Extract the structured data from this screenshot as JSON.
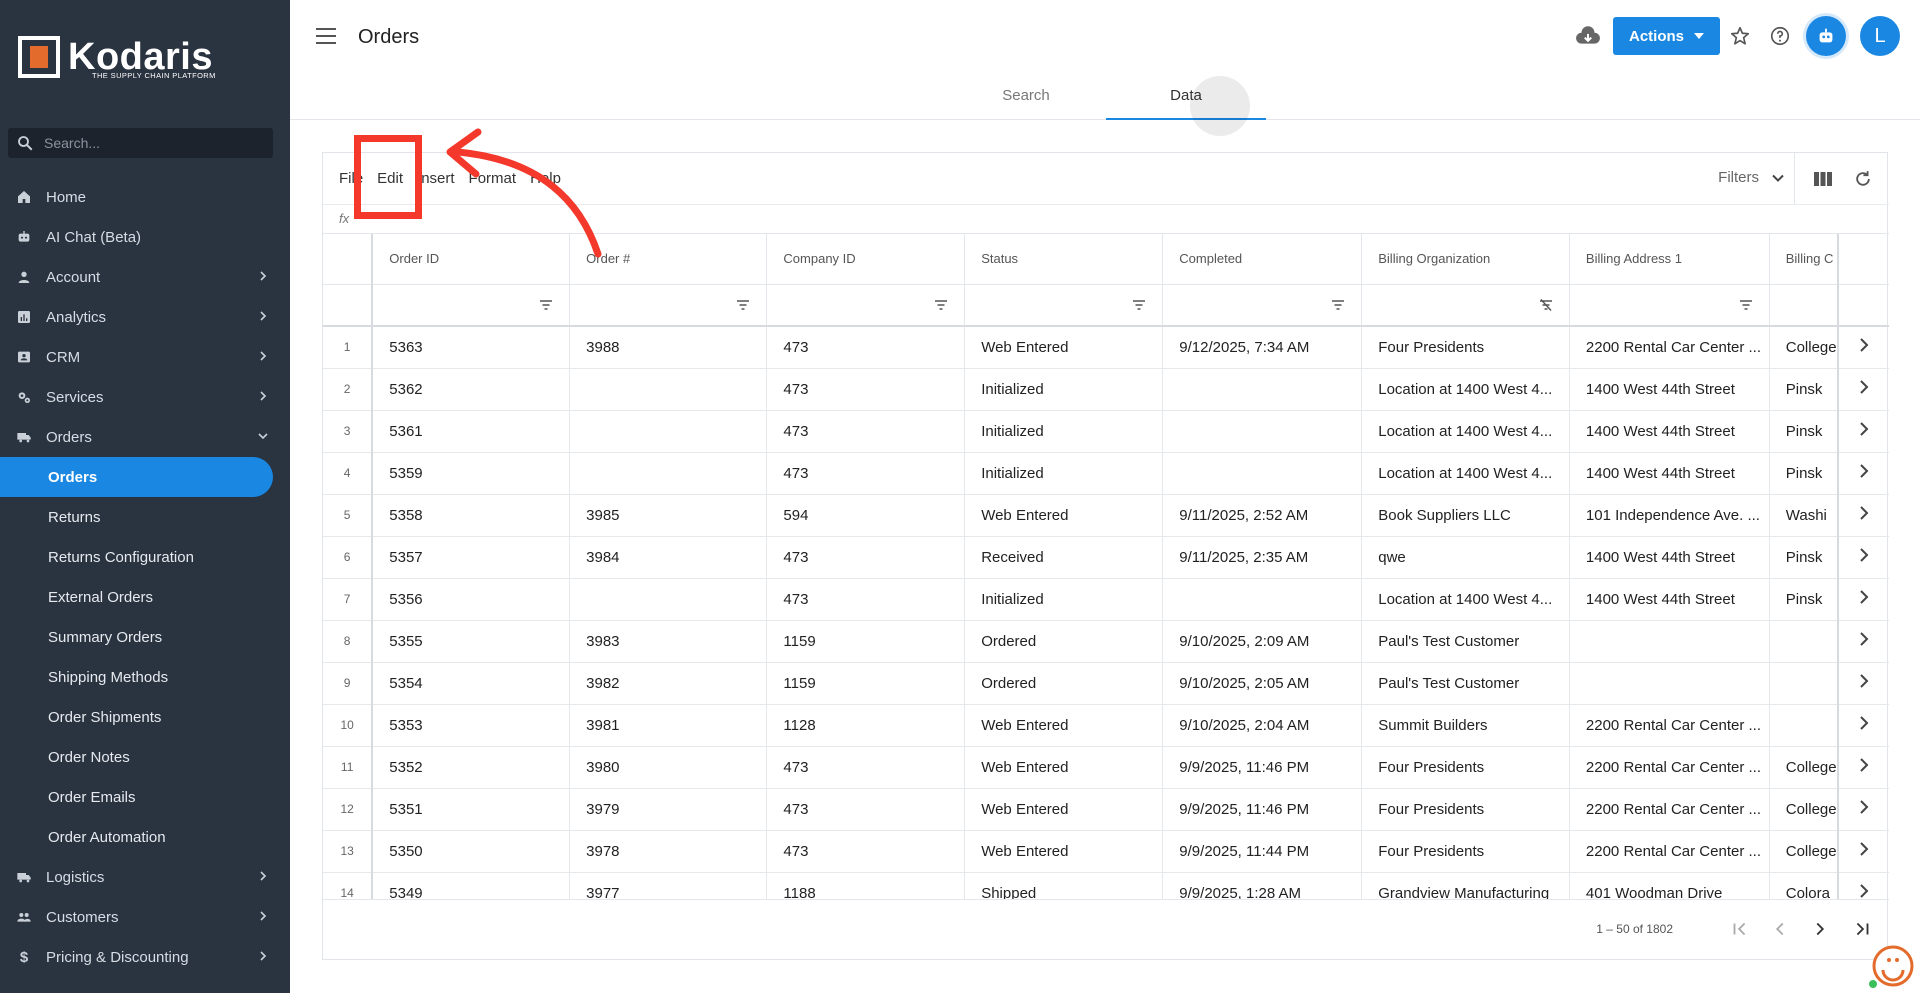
{
  "sidebar": {
    "logo_text": "Kodaris",
    "logo_tagline": "THE SUPPLY CHAIN PLATFORM",
    "search_placeholder": "Search...",
    "items": [
      {
        "label": "Home",
        "icon": "home-icon"
      },
      {
        "label": "AI Chat (Beta)",
        "icon": "robot-icon"
      },
      {
        "label": "Account",
        "icon": "person-icon"
      },
      {
        "label": "Analytics",
        "icon": "analytics-icon"
      },
      {
        "label": "CRM",
        "icon": "contact-card-icon"
      },
      {
        "label": "Services",
        "icon": "gears-icon"
      },
      {
        "label": "Orders",
        "icon": "truck-icon"
      }
    ],
    "order_subitems": [
      "Orders",
      "Returns",
      "Returns Configuration",
      "External Orders",
      "Summary Orders",
      "Shipping Methods",
      "Order Shipments",
      "Order Notes",
      "Order Emails",
      "Order Automation"
    ],
    "bottom_items": [
      {
        "label": "Logistics",
        "icon": "truck-icon"
      },
      {
        "label": "Customers",
        "icon": "people-icon"
      },
      {
        "label": "Pricing & Discounting",
        "icon": "dollar-icon"
      }
    ]
  },
  "header": {
    "title": "Orders",
    "tabs": [
      "Search",
      "Data"
    ],
    "active_tab": "Data",
    "actions_label": "Actions",
    "avatar_initial": "L"
  },
  "toolbar": {
    "menu": [
      "File",
      "Edit",
      "Insert",
      "Format",
      "Help"
    ],
    "filters_label": "Filters",
    "fx_label": "fx"
  },
  "grid": {
    "columns": [
      "Order ID",
      "Order #",
      "Company ID",
      "Status",
      "Completed",
      "Billing Organization",
      "Billing Address 1",
      "Billing C"
    ],
    "rows": [
      [
        "1",
        "5363",
        "3988",
        "473",
        "Web Entered",
        "9/12/2025, 7:34 AM",
        "Four Presidents",
        "2200 Rental Car Center ...",
        "College"
      ],
      [
        "2",
        "5362",
        "",
        "473",
        "Initialized",
        "",
        "Location at 1400 West 4...",
        "1400 West 44th Street",
        "Pinsk"
      ],
      [
        "3",
        "5361",
        "",
        "473",
        "Initialized",
        "",
        "Location at 1400 West 4...",
        "1400 West 44th Street",
        "Pinsk"
      ],
      [
        "4",
        "5359",
        "",
        "473",
        "Initialized",
        "",
        "Location at 1400 West 4...",
        "1400 West 44th Street",
        "Pinsk"
      ],
      [
        "5",
        "5358",
        "3985",
        "594",
        "Web Entered",
        "9/11/2025, 2:52 AM",
        "Book Suppliers LLC",
        "101 Independence Ave. ...",
        "Washi"
      ],
      [
        "6",
        "5357",
        "3984",
        "473",
        "Received",
        "9/11/2025, 2:35 AM",
        "qwe",
        "1400 West 44th Street",
        "Pinsk"
      ],
      [
        "7",
        "5356",
        "",
        "473",
        "Initialized",
        "",
        "Location at 1400 West 4...",
        "1400 West 44th Street",
        "Pinsk"
      ],
      [
        "8",
        "5355",
        "3983",
        "1159",
        "Ordered",
        "9/10/2025, 2:09 AM",
        "Paul's Test Customer",
        "",
        ""
      ],
      [
        "9",
        "5354",
        "3982",
        "1159",
        "Ordered",
        "9/10/2025, 2:05 AM",
        "Paul's Test Customer",
        "",
        ""
      ],
      [
        "10",
        "5353",
        "3981",
        "1128",
        "Web Entered",
        "9/10/2025, 2:04 AM",
        "Summit Builders",
        "2200 Rental Car Center ...",
        ""
      ],
      [
        "11",
        "5352",
        "3980",
        "473",
        "Web Entered",
        "9/9/2025, 11:46 PM",
        "Four Presidents",
        "2200 Rental Car Center ...",
        "College"
      ],
      [
        "12",
        "5351",
        "3979",
        "473",
        "Web Entered",
        "9/9/2025, 11:46 PM",
        "Four Presidents",
        "2200 Rental Car Center ...",
        "College"
      ],
      [
        "13",
        "5350",
        "3978",
        "473",
        "Web Entered",
        "9/9/2025, 11:44 PM",
        "Four Presidents",
        "2200 Rental Car Center ...",
        "College"
      ],
      [
        "14",
        "5349",
        "3977",
        "1188",
        "Shipped",
        "9/9/2025, 1:28 AM",
        "Grandview Manufacturing",
        "401 Woodman Drive",
        "Colora"
      ]
    ],
    "pagination": "1 – 50 of 1802"
  },
  "colors": {
    "sidebar_bg": "#2a3340",
    "accent": "#1a87e2",
    "annotation": "#f4382c",
    "logo_orange": "#e36b2c"
  }
}
